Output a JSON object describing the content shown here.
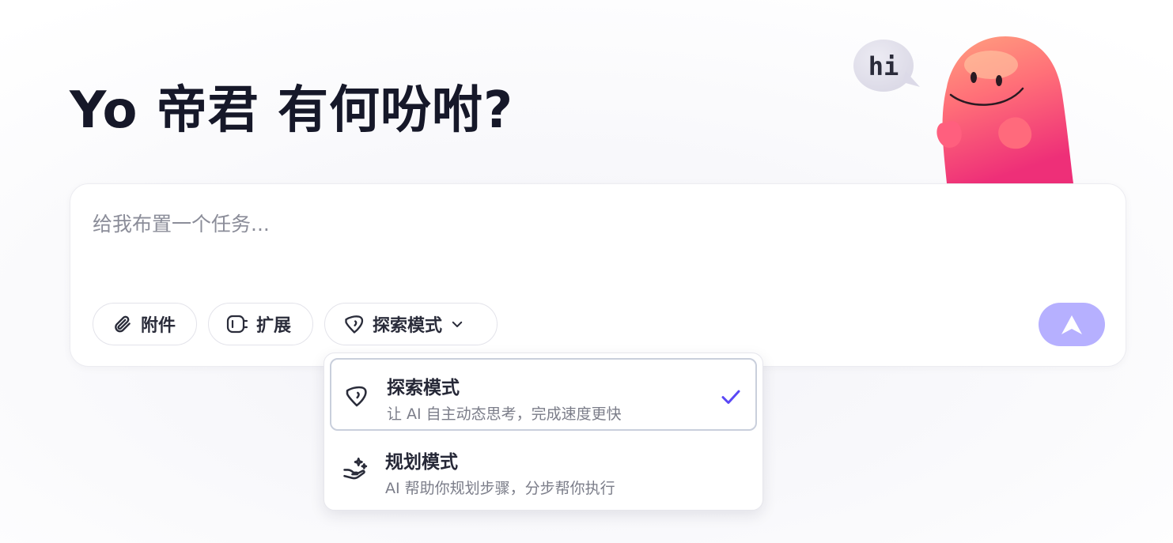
{
  "greeting": {
    "title": "Yo 帝君 有何吩咐?"
  },
  "mascot": {
    "speech": "hi",
    "icon": "mascot-illustration"
  },
  "composer": {
    "placeholder": "给我布置一个任务...",
    "value": "",
    "toolbar": {
      "attach_label": "附件",
      "extend_label": "扩展",
      "mode_label": "探索模式"
    },
    "send_color": "#b6b0ff"
  },
  "mode_menu": {
    "options": [
      {
        "title": "探索模式",
        "description": "让 AI 自主动态思考，完成速度更快",
        "selected": true,
        "icon": "explore-tag-icon"
      },
      {
        "title": "规划模式",
        "description": "AI 帮助你规划步骤，分步帮你执行",
        "selected": false,
        "icon": "plan-hand-sparkle-icon"
      }
    ],
    "check_color": "#5a48f5"
  }
}
